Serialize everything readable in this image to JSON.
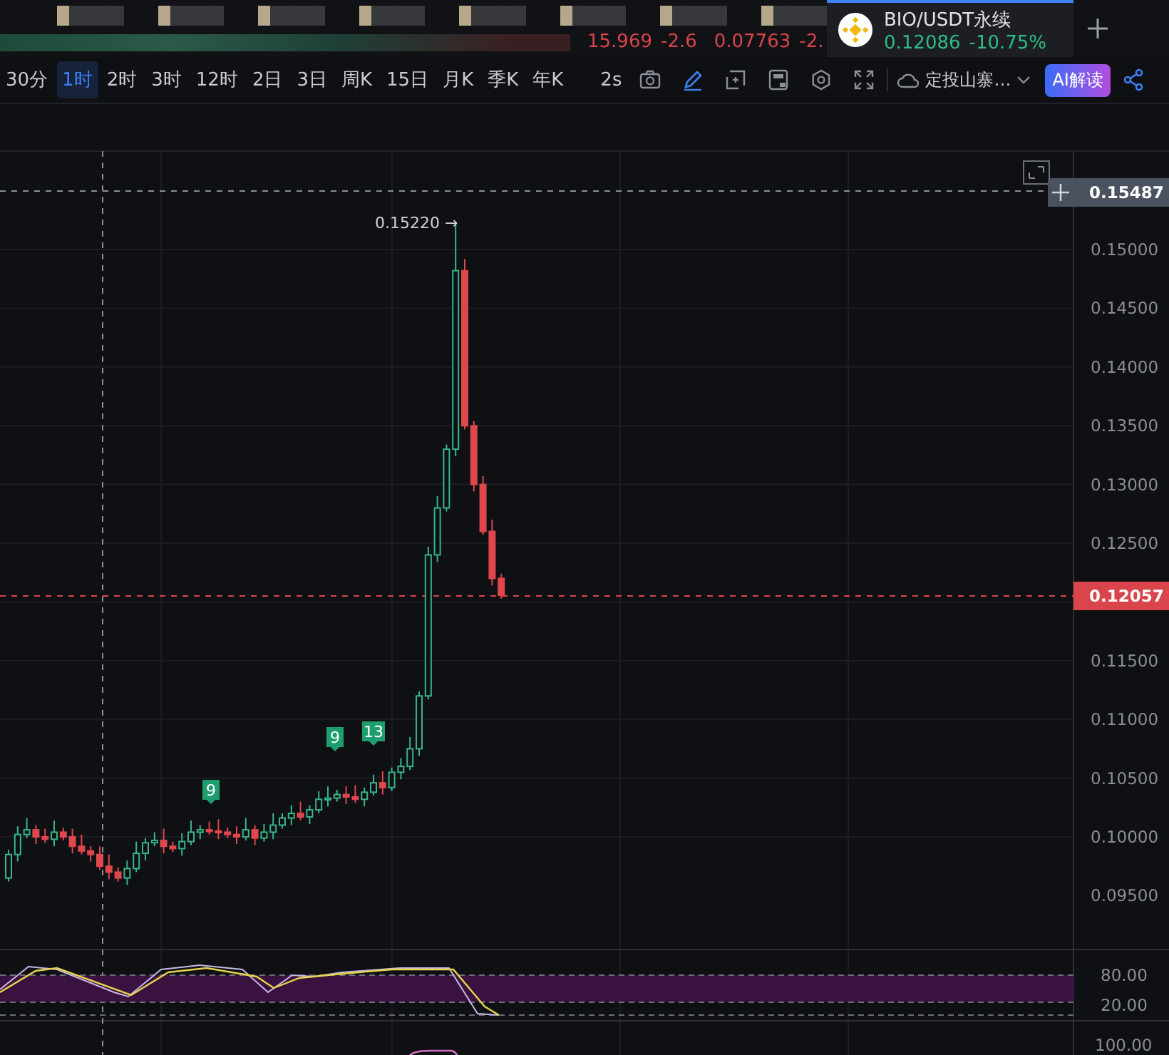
{
  "ticker_strip": [
    {
      "price": "15.969",
      "change": "-2.6"
    },
    {
      "price": "0.07763",
      "change": "-2."
    }
  ],
  "active_tab": {
    "symbol": "BIO/USDT永续",
    "price": "0.12086",
    "change": "-10.75%"
  },
  "intervals": [
    {
      "label": "30分",
      "selected": false
    },
    {
      "label": "1时",
      "selected": true
    },
    {
      "label": "2时",
      "selected": false
    },
    {
      "label": "3时",
      "selected": false
    },
    {
      "label": "12时",
      "selected": false
    },
    {
      "label": "2日",
      "selected": false
    },
    {
      "label": "3日",
      "selected": false
    },
    {
      "label": "周K",
      "selected": false
    },
    {
      "label": "15日",
      "selected": false
    },
    {
      "label": "月K",
      "selected": false
    },
    {
      "label": "季K",
      "selected": false
    },
    {
      "label": "年K",
      "selected": false
    }
  ],
  "speed": "2s",
  "strategy": "定投山寨…",
  "ai_button": "AI解读",
  "price_axis": {
    "crosshair_label": "0.15487",
    "last_price": "0.12057",
    "ticks": [
      "0.15000",
      "0.14500",
      "0.14000",
      "0.13500",
      "0.13000",
      "0.12500",
      "0.11500",
      "0.11000",
      "0.10500",
      "0.10000",
      "0.09500"
    ]
  },
  "peak_label": "0.15220 →",
  "signals": [
    "9",
    "9",
    "13"
  ],
  "stoch_axis": [
    "80.00",
    "20.00"
  ],
  "next_panel_tick": "100.00"
}
